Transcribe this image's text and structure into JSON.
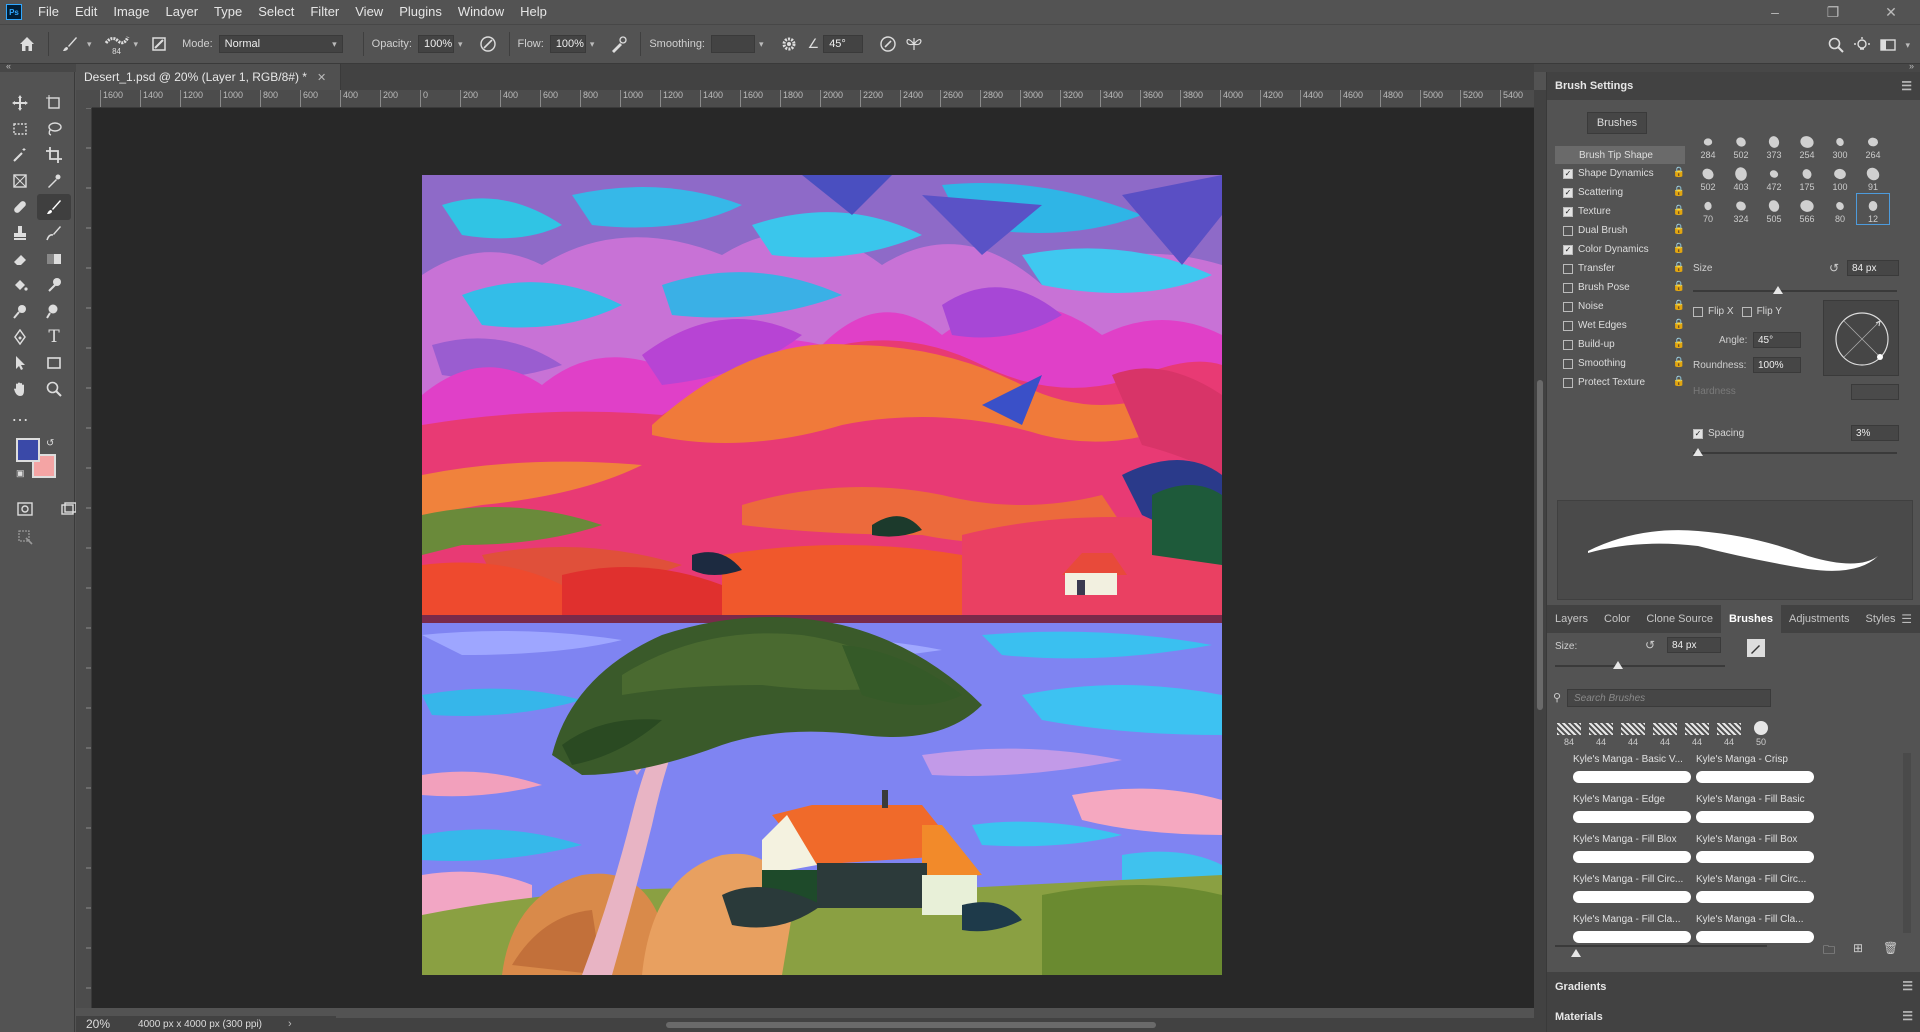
{
  "menubar": {
    "logo": "Ps",
    "items": [
      "File",
      "Edit",
      "Image",
      "Layer",
      "Type",
      "Select",
      "Filter",
      "View",
      "Plugins",
      "Window",
      "Help"
    ]
  },
  "options": {
    "brush_size": "84",
    "mode_label": "Mode:",
    "mode_value": "Normal",
    "opacity_label": "Opacity:",
    "opacity_value": "100%",
    "flow_label": "Flow:",
    "flow_value": "100%",
    "smoothing_label": "Smoothing:",
    "smoothing_value": "",
    "angle_value": "45°"
  },
  "document": {
    "tab_title": "Desert_1.psd @ 20% (Layer 1, RGB/8#) *",
    "zoom": "20%",
    "doc_info": "4000 px x 4000 px (300 ppi)"
  },
  "ruler": {
    "h_labels": [
      "1600",
      "1400",
      "1200",
      "1000",
      "800",
      "600",
      "400",
      "200",
      "0",
      "200",
      "400",
      "600",
      "800",
      "1000",
      "1200",
      "1400",
      "1600",
      "1800",
      "2000",
      "2200",
      "2400",
      "2600",
      "2800",
      "3000",
      "3200",
      "3400",
      "3600",
      "3800",
      "4000",
      "4200",
      "4400",
      "4600",
      "4800",
      "5000",
      "5200",
      "5400"
    ]
  },
  "colors": {
    "foreground": "#3a49a8",
    "background": "#f4a4a4",
    "accent": "#4d9bdc"
  },
  "brush_settings": {
    "title": "Brush Settings",
    "brushes_button": "Brushes",
    "options": [
      {
        "label": "Brush Tip Shape",
        "checkbox": false,
        "checked": false
      },
      {
        "label": "Shape Dynamics",
        "checkbox": true,
        "checked": true
      },
      {
        "label": "Scattering",
        "checkbox": true,
        "checked": true
      },
      {
        "label": "Texture",
        "checkbox": true,
        "checked": true
      },
      {
        "label": "Dual Brush",
        "checkbox": true,
        "checked": false
      },
      {
        "label": "Color Dynamics",
        "checkbox": true,
        "checked": true
      },
      {
        "label": "Transfer",
        "checkbox": true,
        "checked": false
      },
      {
        "label": "Brush Pose",
        "checkbox": true,
        "checked": false
      },
      {
        "label": "Noise",
        "checkbox": true,
        "checked": false
      },
      {
        "label": "Wet Edges",
        "checkbox": true,
        "checked": false
      },
      {
        "label": "Build-up",
        "checkbox": true,
        "checked": false
      },
      {
        "label": "Smoothing",
        "checkbox": true,
        "checked": false
      },
      {
        "label": "Protect Texture",
        "checkbox": true,
        "checked": false
      }
    ],
    "tip_sizes": [
      "284",
      "502",
      "373",
      "254",
      "300",
      "264",
      "502",
      "403",
      "472",
      "175",
      "100",
      "91",
      "70",
      "324",
      "505",
      "566",
      "80",
      "12"
    ],
    "size_label": "Size",
    "size_value": "84 px",
    "flip_x": "Flip X",
    "flip_y": "Flip Y",
    "angle_label": "Angle:",
    "angle_value": "45°",
    "roundness_label": "Roundness:",
    "roundness_value": "100%",
    "hardness_label": "Hardness",
    "spacing_label": "Spacing",
    "spacing_value": "3%"
  },
  "brushes_panel": {
    "tabs": [
      "Layers",
      "Color",
      "Clone Source",
      "Brushes",
      "Adjustments",
      "Styles"
    ],
    "active_tab": "Brushes",
    "size_label": "Size:",
    "size_value": "84 px",
    "search_placeholder": "Search Brushes",
    "recent_sizes": [
      "84",
      "44",
      "44",
      "44",
      "44",
      "44",
      "50"
    ],
    "items": [
      "Kyle's Manga - Basic V...",
      "Kyle's Manga - Crisp",
      "Kyle's Manga - Edge",
      "Kyle's Manga - Fill Basic",
      "Kyle's Manga - Fill Blox",
      "Kyle's Manga - Fill Box",
      "Kyle's Manga - Fill Circ...",
      "Kyle's Manga - Fill Circ...",
      "Kyle's Manga - Fill Cla...",
      "Kyle's Manga - Fill Cla..."
    ]
  },
  "collapsed_panels": {
    "gradients": "Gradients",
    "materials": "Materials"
  }
}
